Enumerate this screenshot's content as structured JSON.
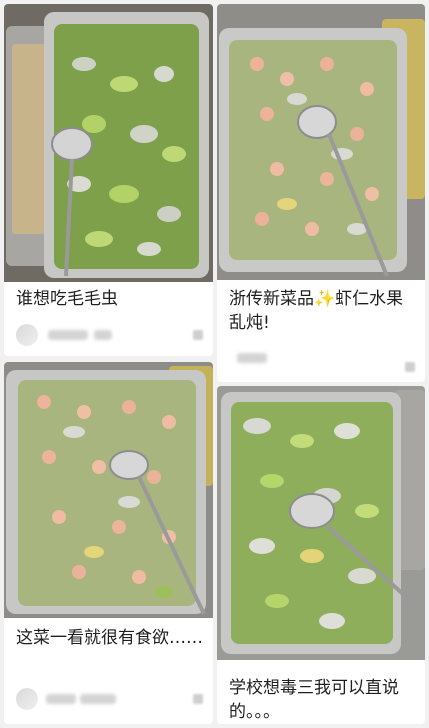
{
  "posts": [
    {
      "title": "谁想吃毛毛虫"
    },
    {
      "title": "浙传新菜品✨虾仁水果乱炖!"
    },
    {
      "title": "这菜一看就很有食欲……"
    },
    {
      "title": "学校想毒三我可以直说的。。。"
    }
  ],
  "colors": {
    "background": "#f1f1f1",
    "card": "#ffffff",
    "tray": "#b9b9b9",
    "food_green": "#9cc05a",
    "shrimp": "#f2b8a2",
    "dragonfruit": "#d8d8d8"
  }
}
